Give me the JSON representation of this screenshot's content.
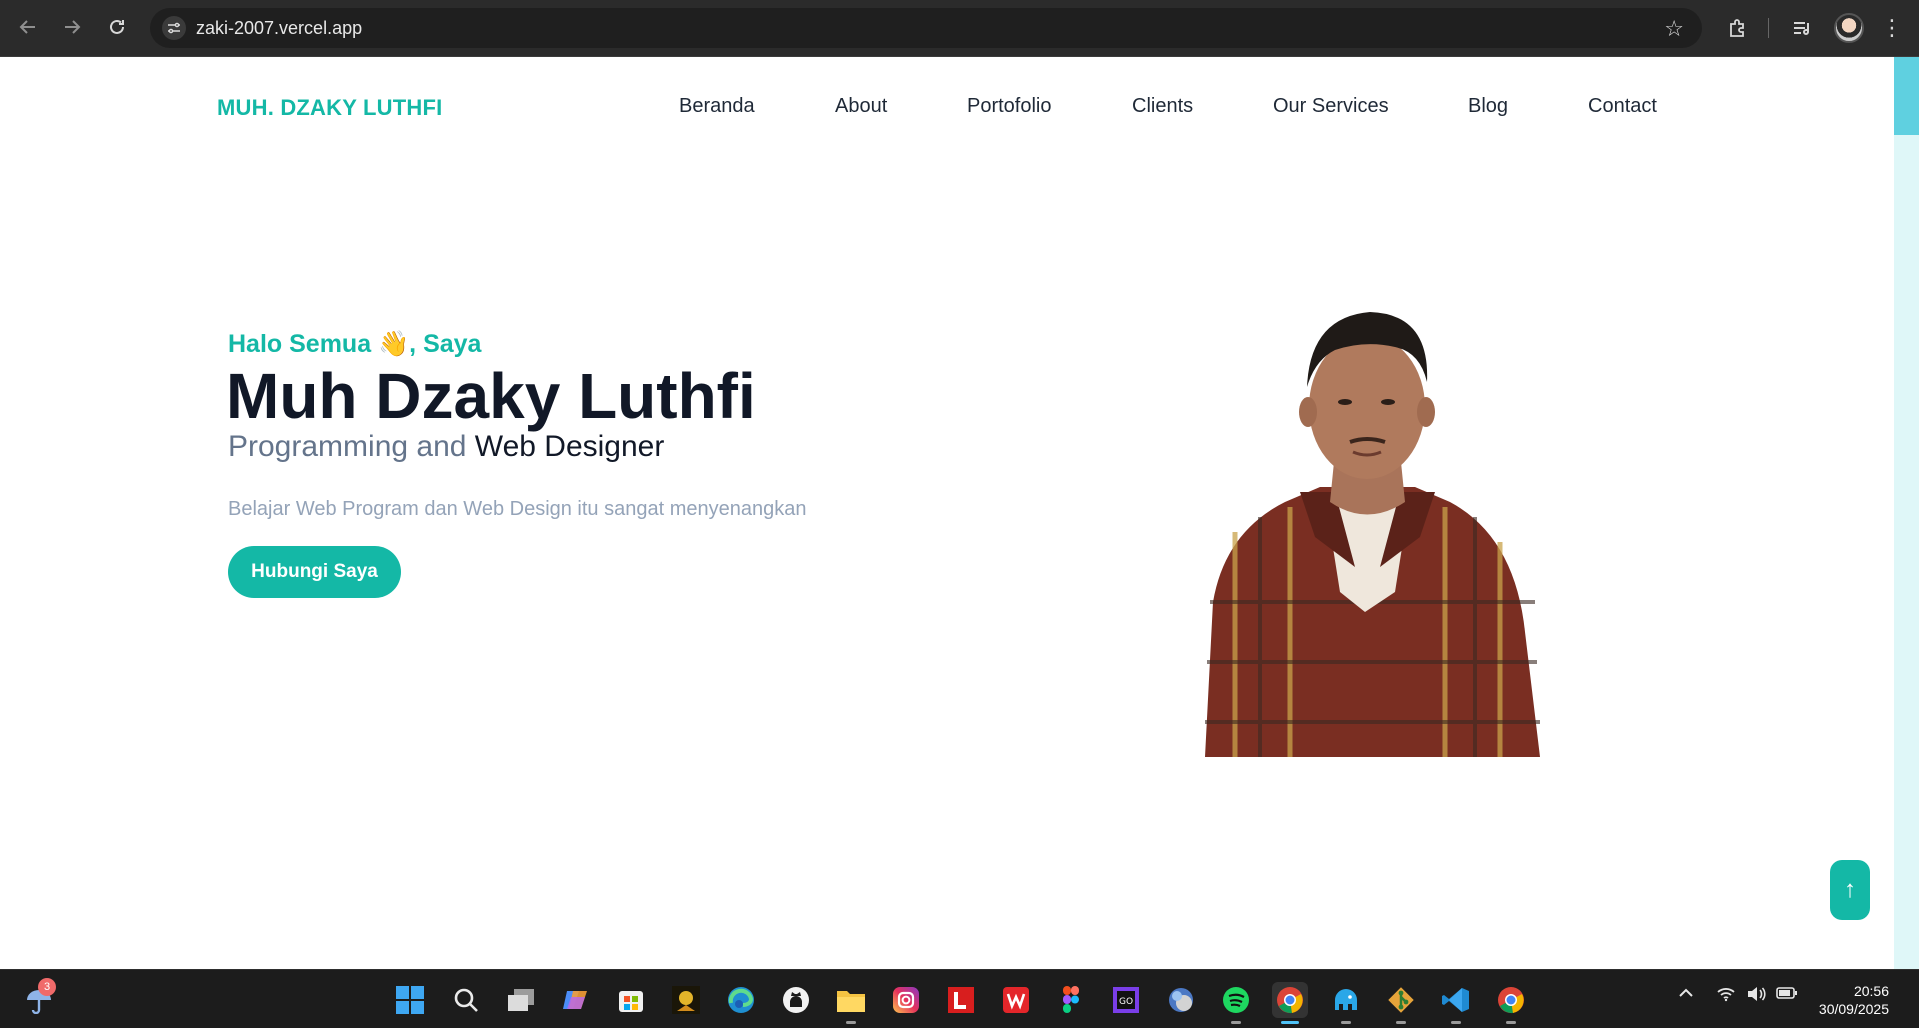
{
  "browser": {
    "url": "zaki-2007.vercel.app",
    "back_icon": "arrow-left-icon",
    "forward_icon": "arrow-right-icon",
    "reload_icon": "reload-icon"
  },
  "header": {
    "brand": "MUH. DZAKY LUTHFI",
    "nav": [
      "Beranda",
      "About",
      "Portofolio",
      "Clients",
      "Our Services",
      "Blog",
      "Contact"
    ]
  },
  "hero": {
    "greeting": "Halo Semua 👋, Saya",
    "name": "Muh Dzaky Luthfi",
    "role_prefix": "Programming and ",
    "role_highlight": "Web Designer",
    "tagline": "Belajar Web Program dan Web Design itu sangat menyenangkan",
    "cta_label": "Hubungi Saya"
  },
  "scroll_top_label": "↑",
  "colors": {
    "accent": "#14b8a6",
    "heading": "#111827",
    "muted": "#64748b",
    "tagline": "#94a3b8"
  },
  "taskbar": {
    "notification_count": "3",
    "time": "20:56",
    "date": "30/09/2025",
    "apps": [
      "windows-start-icon",
      "search-icon",
      "task-view-icon",
      "copilot-icon",
      "microsoft-store-icon",
      "game-icon",
      "edge-browser-icon",
      "github-icon",
      "file-explorer-icon",
      "instagram-icon",
      "l-app-icon",
      "wps-office-icon",
      "figma-icon",
      "go-app-icon",
      "photos-icon",
      "spotify-icon",
      "chrome-profile-icon",
      "elephant-app-icon",
      "git-icon",
      "vscode-icon",
      "chrome-icon"
    ]
  }
}
